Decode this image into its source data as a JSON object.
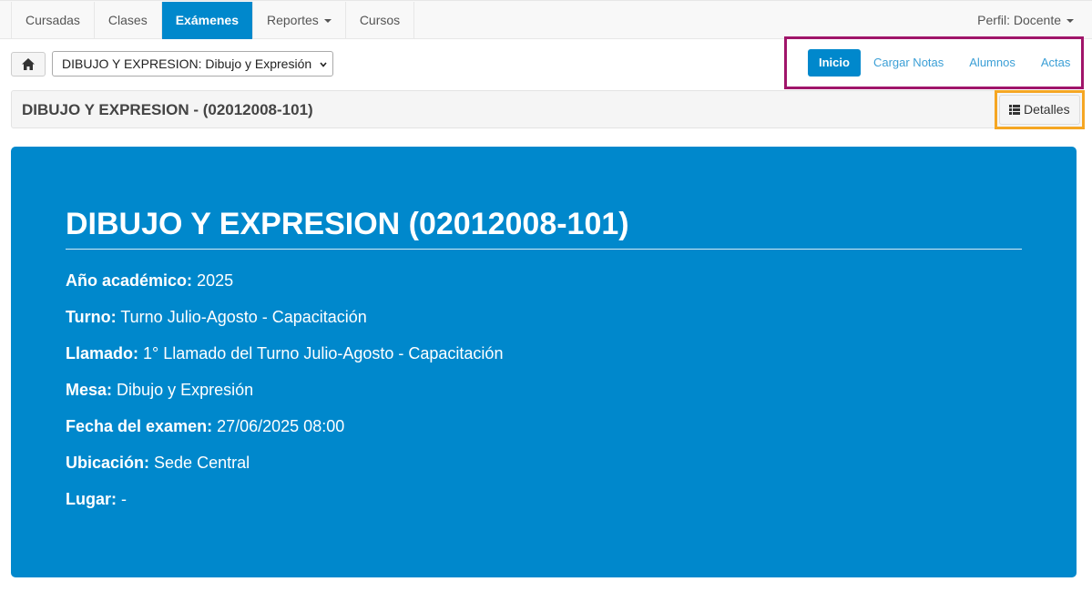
{
  "nav": {
    "items": [
      {
        "label": "Cursadas",
        "active": false
      },
      {
        "label": "Clases",
        "active": false
      },
      {
        "label": "Exámenes",
        "active": true
      },
      {
        "label": "Reportes",
        "active": false,
        "dropdown": true
      },
      {
        "label": "Cursos",
        "active": false
      }
    ],
    "profile_label": "Perfil: Docente"
  },
  "toolbar": {
    "home_icon": "home-icon",
    "subject_select_value": "DIBUJO Y EXPRESION: Dibujo y Expresión"
  },
  "pills": [
    {
      "label": "Inicio",
      "active": true
    },
    {
      "label": "Cargar Notas",
      "active": false
    },
    {
      "label": "Alumnos",
      "active": false
    },
    {
      "label": "Actas",
      "active": false
    }
  ],
  "title_bar": {
    "title": "DIBUJO Y EXPRESION - (02012008-101)",
    "details_label": "Detalles",
    "details_icon": "list-icon"
  },
  "panel": {
    "heading": "DIBUJO Y EXPRESION (02012008-101)",
    "fields": [
      {
        "label": "Año académico:",
        "value": "2025"
      },
      {
        "label": "Turno:",
        "value": "Turno Julio-Agosto - Capacitación"
      },
      {
        "label": "Llamado:",
        "value": "1° Llamado del Turno Julio-Agosto - Capacitación"
      },
      {
        "label": "Mesa:",
        "value": "Dibujo y Expresión"
      },
      {
        "label": "Fecha del examen:",
        "value": "27/06/2025 08:00"
      },
      {
        "label": "Ubicación:",
        "value": "Sede Central"
      },
      {
        "label": "Lugar:",
        "value": "-"
      }
    ]
  },
  "colors": {
    "primary": "#0088cc",
    "pill_highlight_border": "#a0156a",
    "details_highlight_border": "#f5a623",
    "pill_link": "#3b9fd6"
  }
}
